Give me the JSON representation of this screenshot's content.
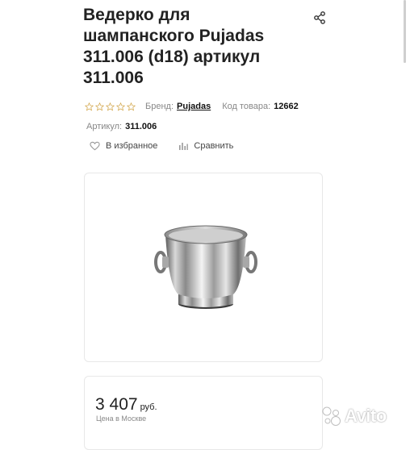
{
  "product": {
    "title": "Ведерко для шампанского Pujadas 311.006 (d18) артикул 311.006",
    "rating_stars": 0,
    "brand_label": "Бренд:",
    "brand_name": "Pujadas",
    "code_label": "Код товара:",
    "code_value": "12662",
    "article_label": "Артикул:",
    "article_value": "311.006"
  },
  "actions": {
    "favorite_label": "В избранное",
    "compare_label": "Сравнить"
  },
  "price": {
    "value": "3 407",
    "unit": "руб.",
    "note": "Цена в Москве"
  },
  "watermark": {
    "text": "Avito"
  },
  "icons": [
    "share-icon",
    "star-icon",
    "heart-icon",
    "compare-icon"
  ],
  "colors": {
    "text": "#222222",
    "muted": "#888888",
    "border": "#e8e8e8",
    "star_outline": "#d2a64a"
  }
}
